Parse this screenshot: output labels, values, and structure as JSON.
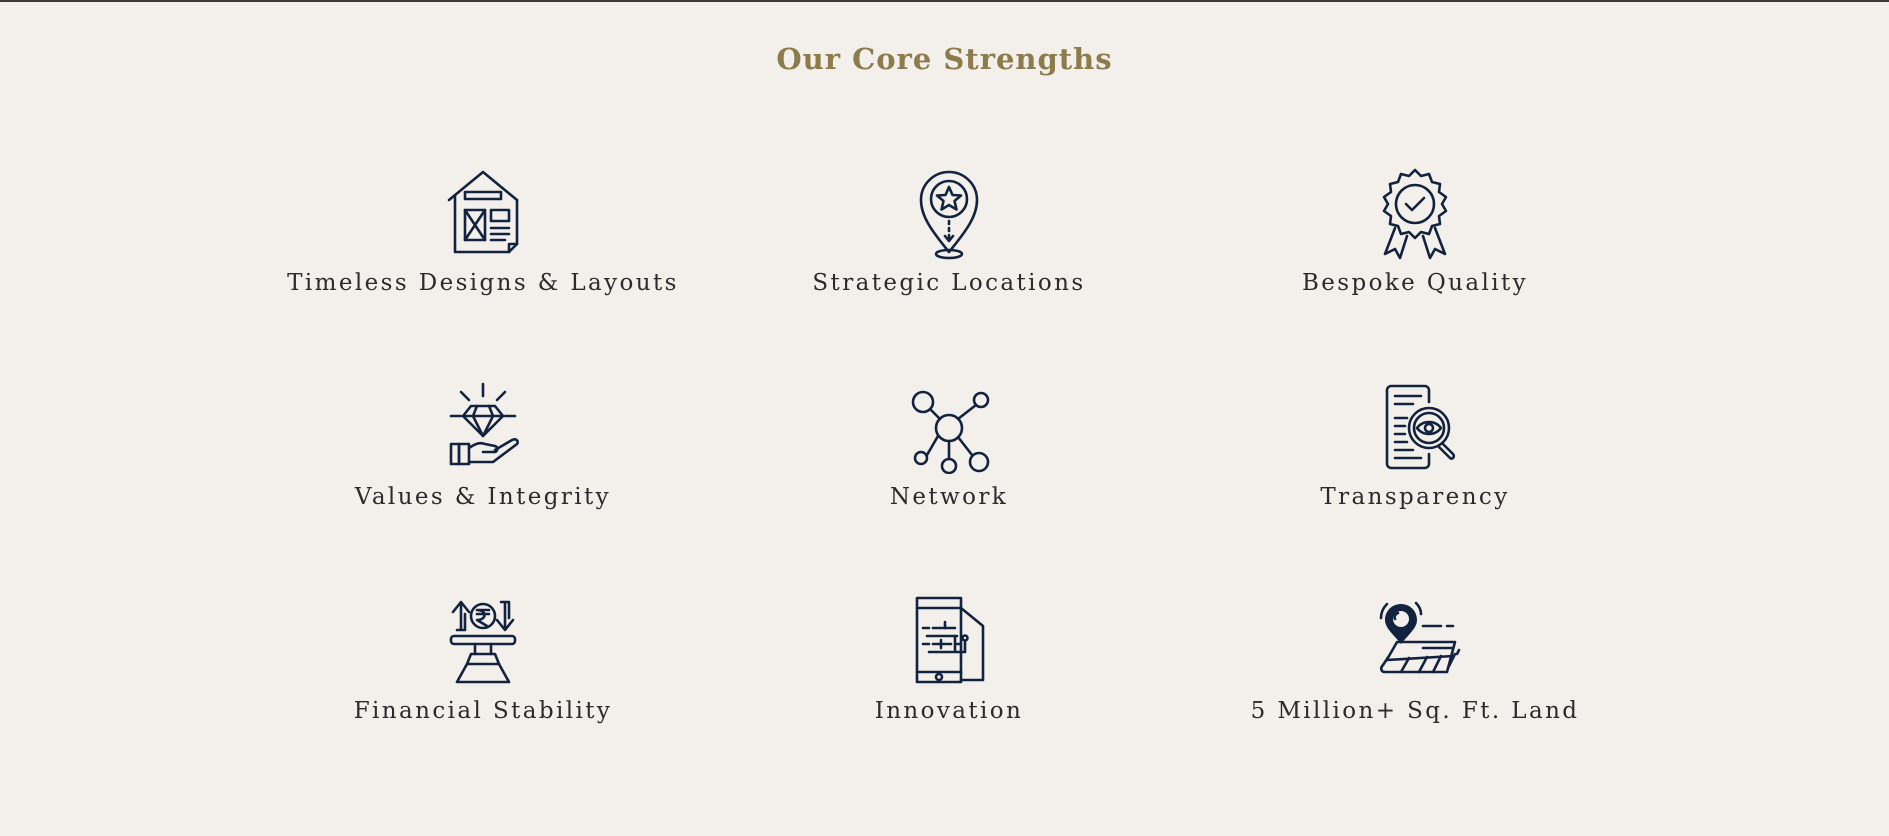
{
  "section": {
    "title": "Our Core Strengths"
  },
  "strengths": [
    {
      "label": "Timeless Designs & Layouts",
      "icon": "house-blueprint-icon"
    },
    {
      "label": "Strategic Locations",
      "icon": "location-pin-star-icon"
    },
    {
      "label": "Bespoke Quality",
      "icon": "quality-badge-icon"
    },
    {
      "label": "Values & Integrity",
      "icon": "diamond-in-hand-icon"
    },
    {
      "label": "Network",
      "icon": "network-nodes-icon"
    },
    {
      "label": "Transparency",
      "icon": "document-magnifier-eye-icon"
    },
    {
      "label": "Financial Stability",
      "icon": "rupee-balance-icon"
    },
    {
      "label": "Innovation",
      "icon": "smart-home-phone-icon"
    },
    {
      "label": "5 Million+ Sq. Ft. Land",
      "icon": "land-plot-pin-icon"
    }
  ],
  "colors": {
    "background": "#f3efea",
    "title": "#8c7b4b",
    "icon": "#12233f",
    "label": "#2b2b2b"
  }
}
